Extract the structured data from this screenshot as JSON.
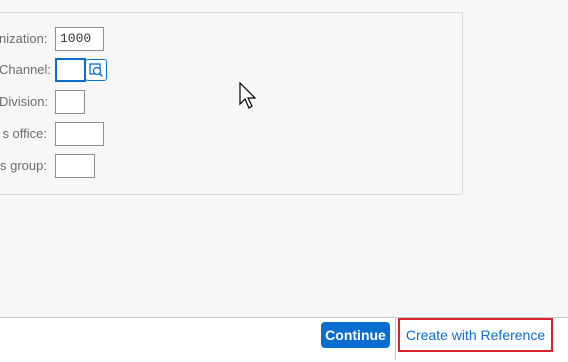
{
  "form": {
    "fields": [
      {
        "label": "nization:",
        "value": "1000"
      },
      {
        "label": "Channel:",
        "value": ""
      },
      {
        "label": "Division:",
        "value": ""
      },
      {
        "label": "s office:",
        "value": ""
      },
      {
        "label": "s group:",
        "value": ""
      }
    ]
  },
  "footer": {
    "continue_label": "Continue",
    "create_with_reference_label": "Create with Reference"
  },
  "colors": {
    "accent": "#0a6ed1",
    "highlight": "#d8232a"
  }
}
